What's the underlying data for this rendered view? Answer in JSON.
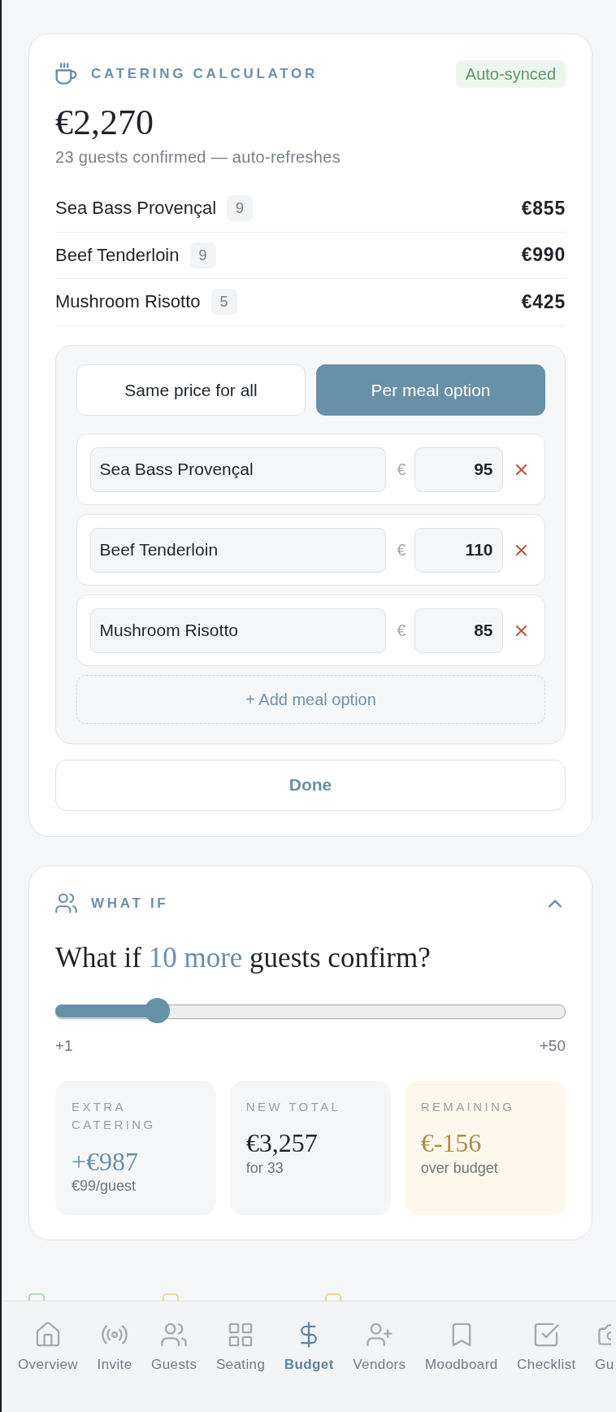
{
  "catering": {
    "title": "CATERING CALCULATOR",
    "sync_badge": "Auto-synced",
    "total": "€2,270",
    "summary": "23 guests confirmed — auto-refreshes",
    "meals": [
      {
        "name": "Sea Bass Provençal",
        "count": "9",
        "cost": "€855"
      },
      {
        "name": "Beef Tenderloin",
        "count": "9",
        "cost": "€990"
      },
      {
        "name": "Mushroom Risotto",
        "count": "5",
        "cost": "€425"
      }
    ],
    "pricing_modes": [
      {
        "label": "Same price for all",
        "selected": false
      },
      {
        "label": "Per meal option",
        "selected": true
      }
    ],
    "meal_options": [
      {
        "name": "Sea Bass Provençal",
        "currency": "€",
        "price": "95"
      },
      {
        "name": "Beef Tenderloin",
        "currency": "€",
        "price": "110"
      },
      {
        "name": "Mushroom Risotto",
        "currency": "€",
        "price": "85"
      }
    ],
    "add_option": "+ Add meal option",
    "done": "Done"
  },
  "what_if": {
    "title": "WHAT IF",
    "expanded": true,
    "question": [
      {
        "text": "What if",
        "highlight": false
      },
      {
        "text": "10 more",
        "highlight": true
      },
      {
        "text": "guests confirm?",
        "highlight": false
      }
    ],
    "slider": {
      "level": 0.184,
      "min_label": "+1",
      "max_label": "+50"
    },
    "stats": [
      {
        "kind": "accent",
        "label": "EXTRA CATERING",
        "value": "+€987",
        "note": "€99/guest"
      },
      {
        "kind": "plain",
        "label": "NEW TOTAL",
        "value": "€3,257",
        "note": "for 33"
      },
      {
        "kind": "warning",
        "label": "REMAINING",
        "value": "€-156",
        "note": "over budget"
      }
    ]
  },
  "legend": [
    {
      "color": "#b5dcbc"
    },
    {
      "color": "#f1d79b"
    },
    {
      "color": "#efd59d"
    }
  ],
  "nav": [
    {
      "label": "Overview",
      "selected": false
    },
    {
      "label": "Invite",
      "selected": false
    },
    {
      "label": "Guests",
      "selected": false
    },
    {
      "label": "Seating",
      "selected": false
    },
    {
      "label": "Budget",
      "selected": true
    },
    {
      "label": "Vendors",
      "selected": false
    },
    {
      "label": "Moodboard",
      "selected": false
    },
    {
      "label": "Checklist",
      "selected": false
    },
    {
      "label": "Gu",
      "selected": false
    }
  ]
}
